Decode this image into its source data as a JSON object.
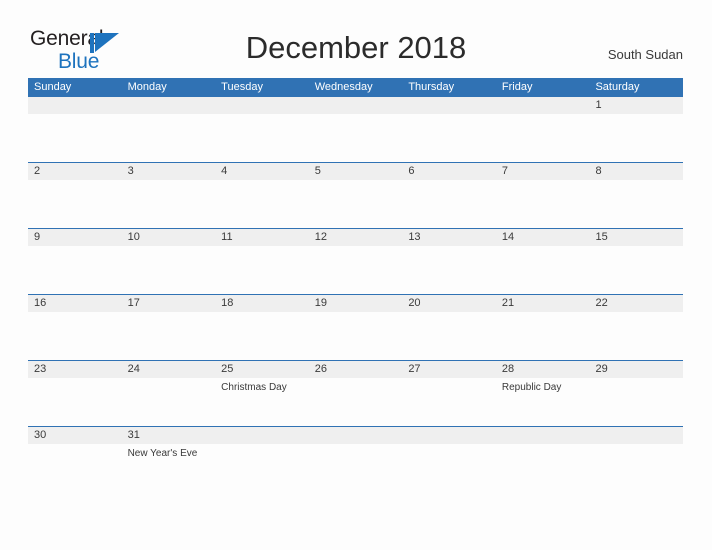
{
  "logo": {
    "text_top": "General",
    "text_bottom": "Blue",
    "mark_icon": "general-blue-flag-icon",
    "color_dark": "#231f20",
    "color_blue": "#1e73be"
  },
  "header": {
    "title": "December 2018",
    "region": "South Sudan"
  },
  "theme": {
    "header_blue": "#3072b4",
    "band_gray": "#efefef",
    "page_background": "#fdfdfd",
    "text_color": "#3a3a3a"
  },
  "weekdays": [
    "Sunday",
    "Monday",
    "Tuesday",
    "Wednesday",
    "Thursday",
    "Friday",
    "Saturday"
  ],
  "weeks": [
    {
      "days": [
        {
          "num": "",
          "event": ""
        },
        {
          "num": "",
          "event": ""
        },
        {
          "num": "",
          "event": ""
        },
        {
          "num": "",
          "event": ""
        },
        {
          "num": "",
          "event": ""
        },
        {
          "num": "",
          "event": ""
        },
        {
          "num": "1",
          "event": ""
        }
      ]
    },
    {
      "days": [
        {
          "num": "2",
          "event": ""
        },
        {
          "num": "3",
          "event": ""
        },
        {
          "num": "4",
          "event": ""
        },
        {
          "num": "5",
          "event": ""
        },
        {
          "num": "6",
          "event": ""
        },
        {
          "num": "7",
          "event": ""
        },
        {
          "num": "8",
          "event": ""
        }
      ]
    },
    {
      "days": [
        {
          "num": "9",
          "event": ""
        },
        {
          "num": "10",
          "event": ""
        },
        {
          "num": "11",
          "event": ""
        },
        {
          "num": "12",
          "event": ""
        },
        {
          "num": "13",
          "event": ""
        },
        {
          "num": "14",
          "event": ""
        },
        {
          "num": "15",
          "event": ""
        }
      ]
    },
    {
      "days": [
        {
          "num": "16",
          "event": ""
        },
        {
          "num": "17",
          "event": ""
        },
        {
          "num": "18",
          "event": ""
        },
        {
          "num": "19",
          "event": ""
        },
        {
          "num": "20",
          "event": ""
        },
        {
          "num": "21",
          "event": ""
        },
        {
          "num": "22",
          "event": ""
        }
      ]
    },
    {
      "days": [
        {
          "num": "23",
          "event": ""
        },
        {
          "num": "24",
          "event": ""
        },
        {
          "num": "25",
          "event": "Christmas Day"
        },
        {
          "num": "26",
          "event": ""
        },
        {
          "num": "27",
          "event": ""
        },
        {
          "num": "28",
          "event": "Republic Day"
        },
        {
          "num": "29",
          "event": ""
        }
      ]
    },
    {
      "days": [
        {
          "num": "30",
          "event": ""
        },
        {
          "num": "31",
          "event": "New Year's Eve"
        },
        {
          "num": "",
          "event": ""
        },
        {
          "num": "",
          "event": ""
        },
        {
          "num": "",
          "event": ""
        },
        {
          "num": "",
          "event": ""
        },
        {
          "num": "",
          "event": ""
        }
      ]
    }
  ]
}
